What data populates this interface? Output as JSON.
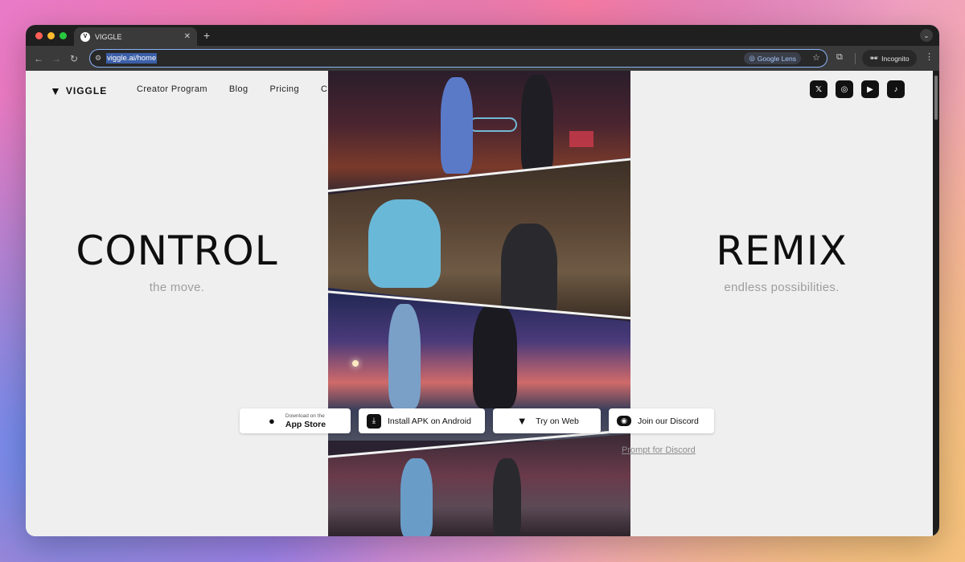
{
  "browser": {
    "tab_title": "VIGGLE",
    "tab_favicon": "V",
    "url": "viggle.ai/home",
    "lens_label": "Google Lens",
    "incognito_label": "Incognito",
    "traffic_lights": [
      "#ff5f57",
      "#febc2e",
      "#28c840"
    ]
  },
  "site": {
    "logo_text": "VIGGLE",
    "nav": [
      "Creator Program",
      "Blog",
      "Pricing",
      "C"
    ],
    "socials": [
      "x-icon",
      "instagram-icon",
      "youtube-icon",
      "tiktok-icon"
    ]
  },
  "hero": {
    "left_title": "CONTROL",
    "left_sub": "the move.",
    "right_title": "REMIX",
    "right_sub": "endless possibilities."
  },
  "downloads": {
    "appstore_small": "Download on the",
    "appstore_big": "App Store",
    "apk": "Install APK on Android",
    "web": "Try on Web",
    "discord": "Join our Discord",
    "prompt_link": "Prompt for Discord"
  }
}
